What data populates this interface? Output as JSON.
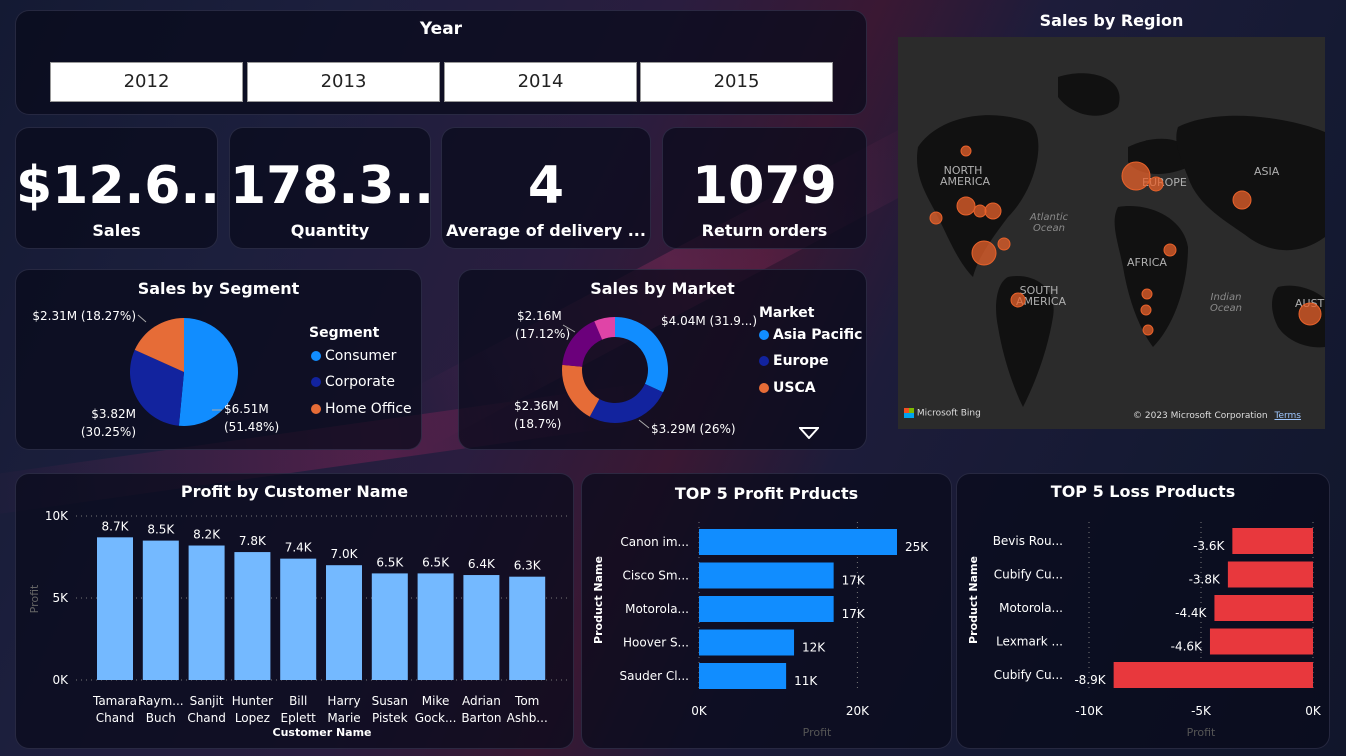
{
  "colors": {
    "blue": "#118dff",
    "navy": "#12239e",
    "orange": "#e66c37",
    "purple": "#6b007b",
    "pink": "#e044a7",
    "bar_light": "#74b9ff",
    "red": "#e8383d",
    "bubble": "#e8622b"
  },
  "year_slicer": {
    "title": "Year",
    "options": [
      "2012",
      "2013",
      "2014",
      "2015"
    ]
  },
  "kpis": [
    {
      "value": "$12.6...",
      "label": "Sales"
    },
    {
      "value": "178.3...",
      "label": "Quantity"
    },
    {
      "value": "4",
      "label": "Average of delivery ..."
    },
    {
      "value": "1079",
      "label": "Return orders"
    }
  ],
  "map": {
    "title": "Sales by Region",
    "labels": [
      "NORTH AMERICA",
      "SOUTH AMERICA",
      "AFRICA",
      "ASIA",
      "AUSTR",
      "EUROPE"
    ],
    "oceans": [
      "Atlantic Ocean",
      "Indian Ocean"
    ],
    "logo_text": "Microsoft Bing",
    "copyright": "© 2023 Microsoft Corporation",
    "terms": "Terms"
  },
  "chart_data": [
    {
      "type": "pie",
      "title": "Sales by Segment",
      "legend_title": "Segment",
      "legend_placement": "right",
      "slices": [
        {
          "name": "Consumer",
          "value": 6.51,
          "label": "$6.51M (51.48%)",
          "percent": 51.48
        },
        {
          "name": "Corporate",
          "value": 3.82,
          "label": "$3.82M (30.25%)",
          "percent": 30.25
        },
        {
          "name": "Home Office",
          "value": 2.31,
          "label": "$2.31M (18.27%)",
          "percent": 18.27
        }
      ]
    },
    {
      "type": "pie",
      "subtype": "donut",
      "title": "Sales by Market",
      "legend_title": "Market",
      "legend_placement": "right",
      "legend_items": [
        "Asia Pacific",
        "Europe",
        "USCA"
      ],
      "slices": [
        {
          "value": 4.04,
          "label": "$4.04M (31.9...)",
          "percent": 31.9
        },
        {
          "value": 3.29,
          "label": "$3.29M (26%)",
          "percent": 26
        },
        {
          "value": 2.36,
          "label": "$2.36M (18.7%)",
          "percent": 18.7
        },
        {
          "value": 2.16,
          "label": "$2.16M (17.12%)",
          "percent": 17.12
        },
        {
          "value": 0.81,
          "label": "",
          "percent": 6.28
        }
      ]
    },
    {
      "type": "bar",
      "title": "Profit by Customer Name",
      "xlabel": "Customer Name",
      "ylabel": "Profit",
      "ylim": [
        0,
        10000
      ],
      "yticks": [
        "0K",
        "5K",
        "10K"
      ],
      "categories": [
        [
          "Tamara",
          "Chand"
        ],
        [
          "Raym...",
          "Buch"
        ],
        [
          "Sanjit",
          "Chand"
        ],
        [
          "Hunter",
          "Lopez"
        ],
        [
          "Bill",
          "Eplett"
        ],
        [
          "Harry",
          "Marie"
        ],
        [
          "Susan",
          "Pistek"
        ],
        [
          "Mike",
          "Gock..."
        ],
        [
          "Adrian",
          "Barton"
        ],
        [
          "Tom",
          "Ashb..."
        ]
      ],
      "values": [
        8700,
        8500,
        8200,
        7800,
        7400,
        7000,
        6500,
        6500,
        6400,
        6300
      ],
      "data_labels": [
        "8.7K",
        "8.5K",
        "8.2K",
        "7.8K",
        "7.4K",
        "7.0K",
        "6.5K",
        "6.5K",
        "6.4K",
        "6.3K"
      ]
    },
    {
      "type": "bar",
      "orientation": "horizontal",
      "title": "TOP 5 Profit Prducts",
      "xlabel": "Profit",
      "ylabel": "Product Name",
      "xlim": [
        0,
        25000
      ],
      "xticks": [
        "0K",
        "20K"
      ],
      "categories": [
        "Canon im...",
        "Cisco Sm...",
        "Motorola...",
        "Hoover S...",
        "Sauder Cl..."
      ],
      "values": [
        25000,
        17000,
        17000,
        12000,
        11000
      ],
      "data_labels": [
        "25K",
        "17K",
        "17K",
        "12K",
        "11K"
      ]
    },
    {
      "type": "bar",
      "orientation": "horizontal",
      "title": "TOP 5 Loss Products",
      "xlabel": "Profit",
      "ylabel": "Product Name",
      "xlim": [
        -10000,
        0
      ],
      "xticks": [
        "-10K",
        "-5K",
        "0K"
      ],
      "categories": [
        "Bevis Rou...",
        "Cubify Cu...",
        "Motorola...",
        "Lexmark ...",
        "Cubify Cu..."
      ],
      "values": [
        -3600,
        -3800,
        -4400,
        -4600,
        -8900
      ],
      "data_labels": [
        "-3.6K",
        "-3.8K",
        "-4.4K",
        "-4.6K",
        "-8.9K"
      ]
    }
  ]
}
